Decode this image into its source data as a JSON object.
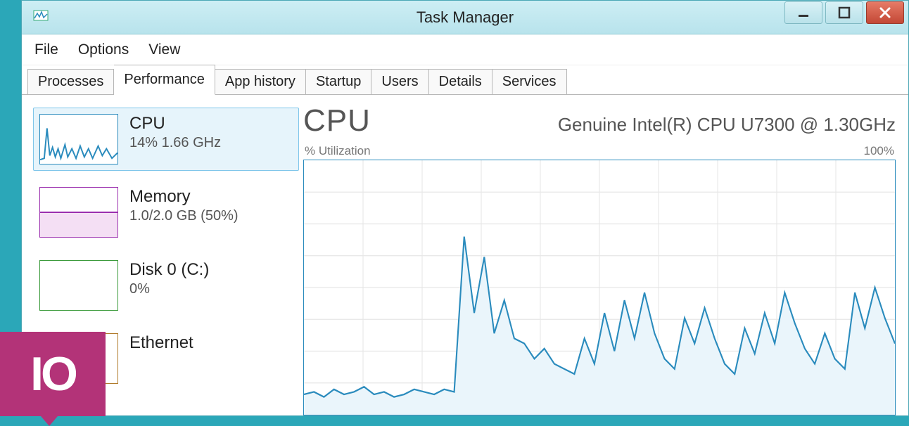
{
  "window": {
    "title": "Task Manager"
  },
  "menu": {
    "items": [
      "File",
      "Options",
      "View"
    ]
  },
  "tabs": {
    "items": [
      "Processes",
      "Performance",
      "App history",
      "Startup",
      "Users",
      "Details",
      "Services"
    ],
    "active_index": 1
  },
  "sidebar": {
    "items": [
      {
        "title": "CPU",
        "sub": "14%  1.66 GHz",
        "color": "#2a8bbd",
        "selected": true
      },
      {
        "title": "Memory",
        "sub": "1.0/2.0 GB (50%)",
        "color": "#9b2fae",
        "selected": false
      },
      {
        "title": "Disk 0 (C:)",
        "sub": "0%",
        "color": "#3a9a3a",
        "selected": false
      },
      {
        "title": "Ethernet",
        "sub": "",
        "color": "#b07a2a",
        "selected": false
      }
    ]
  },
  "main": {
    "title": "CPU",
    "subtitle": "Genuine Intel(R) CPU U7300 @ 1.30GHz",
    "label_left": "% Utilization",
    "label_right": "100%"
  },
  "badge": {
    "text": "IO"
  },
  "chart_data": {
    "type": "line",
    "title": "CPU % Utilization",
    "xlabel": "",
    "ylabel": "% Utilization",
    "ylim": [
      0,
      100
    ],
    "x": [
      0,
      1,
      2,
      3,
      4,
      5,
      6,
      7,
      8,
      9,
      10,
      11,
      12,
      13,
      14,
      15,
      16,
      17,
      18,
      19,
      20,
      21,
      22,
      23,
      24,
      25,
      26,
      27,
      28,
      29,
      30,
      31,
      32,
      33,
      34,
      35,
      36,
      37,
      38,
      39,
      40,
      41,
      42,
      43,
      44,
      45,
      46,
      47,
      48,
      49,
      50,
      51,
      52,
      53,
      54,
      55,
      56,
      57,
      58,
      59
    ],
    "values": [
      8,
      9,
      7,
      10,
      8,
      9,
      11,
      8,
      9,
      7,
      8,
      10,
      9,
      8,
      10,
      9,
      70,
      40,
      62,
      32,
      45,
      30,
      28,
      22,
      26,
      20,
      18,
      16,
      30,
      20,
      40,
      25,
      45,
      30,
      48,
      32,
      22,
      18,
      38,
      28,
      42,
      30,
      20,
      16,
      34,
      24,
      40,
      28,
      48,
      36,
      26,
      20,
      32,
      22,
      18,
      48,
      34,
      50,
      38,
      28
    ]
  }
}
